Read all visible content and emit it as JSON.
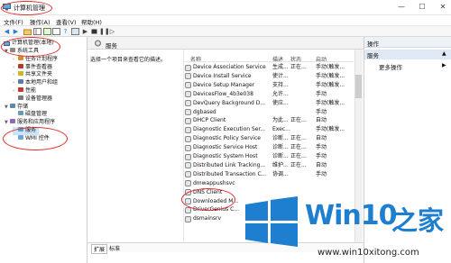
{
  "window": {
    "title": "计算机管理"
  },
  "menu": [
    "文件(F)",
    "操作(A)",
    "查看(V)",
    "帮助(H)"
  ],
  "tree": {
    "root": "计算机管理(本地)",
    "items": [
      {
        "label": "系统工具",
        "level": 1,
        "arrow": "▼"
      },
      {
        "label": "任务计划程序",
        "level": 2,
        "arrow": "›"
      },
      {
        "label": "事件查看器",
        "level": 2,
        "arrow": "›"
      },
      {
        "label": "共享文件夹",
        "level": 2,
        "arrow": "›"
      },
      {
        "label": "本地用户和组",
        "level": 2,
        "arrow": "›"
      },
      {
        "label": "性能",
        "level": 2,
        "arrow": "›"
      },
      {
        "label": "设备管理器",
        "level": 2,
        "arrow": ""
      },
      {
        "label": "存储",
        "level": 1,
        "arrow": "▼"
      },
      {
        "label": "磁盘管理",
        "level": 2,
        "arrow": ""
      },
      {
        "label": "服务和应用程序",
        "level": 1,
        "arrow": "▼"
      },
      {
        "label": "服务",
        "level": 2,
        "arrow": ""
      },
      {
        "label": "WMI 控件",
        "level": 2,
        "arrow": ""
      }
    ]
  },
  "center": {
    "header": "服务",
    "description": "选择一个项目来查看它的描述。",
    "columns": {
      "name": "名称",
      "desc": "描述",
      "status": "状态",
      "startup": "启动"
    },
    "rows": [
      {
        "name": "Device Association Service",
        "desc": "生成...",
        "status": "正在...",
        "startup": "手动(触发..."
      },
      {
        "name": "Device Install Service",
        "desc": "使计...",
        "status": "",
        "startup": "手动(触发..."
      },
      {
        "name": "Device Setup Manager",
        "desc": "支持...",
        "status": "",
        "startup": "手动(触发..."
      },
      {
        "name": "DevicesFlow_4b3e038",
        "desc": "允许...",
        "status": "",
        "startup": "手动"
      },
      {
        "name": "DevQuery Background D...",
        "desc": "使应...",
        "status": "",
        "startup": "手动(触发..."
      },
      {
        "name": "dgbased",
        "desc": "",
        "status": "",
        "startup": "手动"
      },
      {
        "name": "DHCP Client",
        "desc": "为此...",
        "status": "正在...",
        "startup": "自动"
      },
      {
        "name": "Diagnostic Execution Ser...",
        "desc": "Exec...",
        "status": "",
        "startup": "手动(触发..."
      },
      {
        "name": "Diagnostic Policy Service",
        "desc": "诊断...",
        "status": "正在...",
        "startup": "自动"
      },
      {
        "name": "Diagnostic Service Host",
        "desc": "诊断...",
        "status": "正在...",
        "startup": "手动"
      },
      {
        "name": "Diagnostic System Host",
        "desc": "诊断...",
        "status": "正在...",
        "startup": "手动"
      },
      {
        "name": "Distributed Link Tracking...",
        "desc": "维护...",
        "status": "正在...",
        "startup": "自动"
      },
      {
        "name": "Distributed Transaction C...",
        "desc": "协调...",
        "status": "",
        "startup": "手动"
      },
      {
        "name": "dmwappushsvc",
        "desc": "",
        "status": "",
        "startup": ""
      },
      {
        "name": "DNS Client",
        "desc": "",
        "status": "",
        "startup": ""
      },
      {
        "name": "Downloaded M...",
        "desc": "",
        "status": "",
        "startup": ""
      },
      {
        "name": "DriverGenius C...",
        "desc": "",
        "status": "",
        "startup": ""
      },
      {
        "name": "dsmainsrv",
        "desc": "",
        "status": "",
        "startup": ""
      }
    ],
    "tabs": [
      "扩展",
      "标准"
    ]
  },
  "actions": {
    "header": "操作",
    "selected": "服务",
    "more": "更多操作"
  },
  "watermark": {
    "brand": "Win10",
    "brand_cn": "之家",
    "url": "www.win10xitong.com"
  },
  "colors": {
    "annotation": "#e02a2a",
    "brand_blue": "#1e7fd0"
  }
}
